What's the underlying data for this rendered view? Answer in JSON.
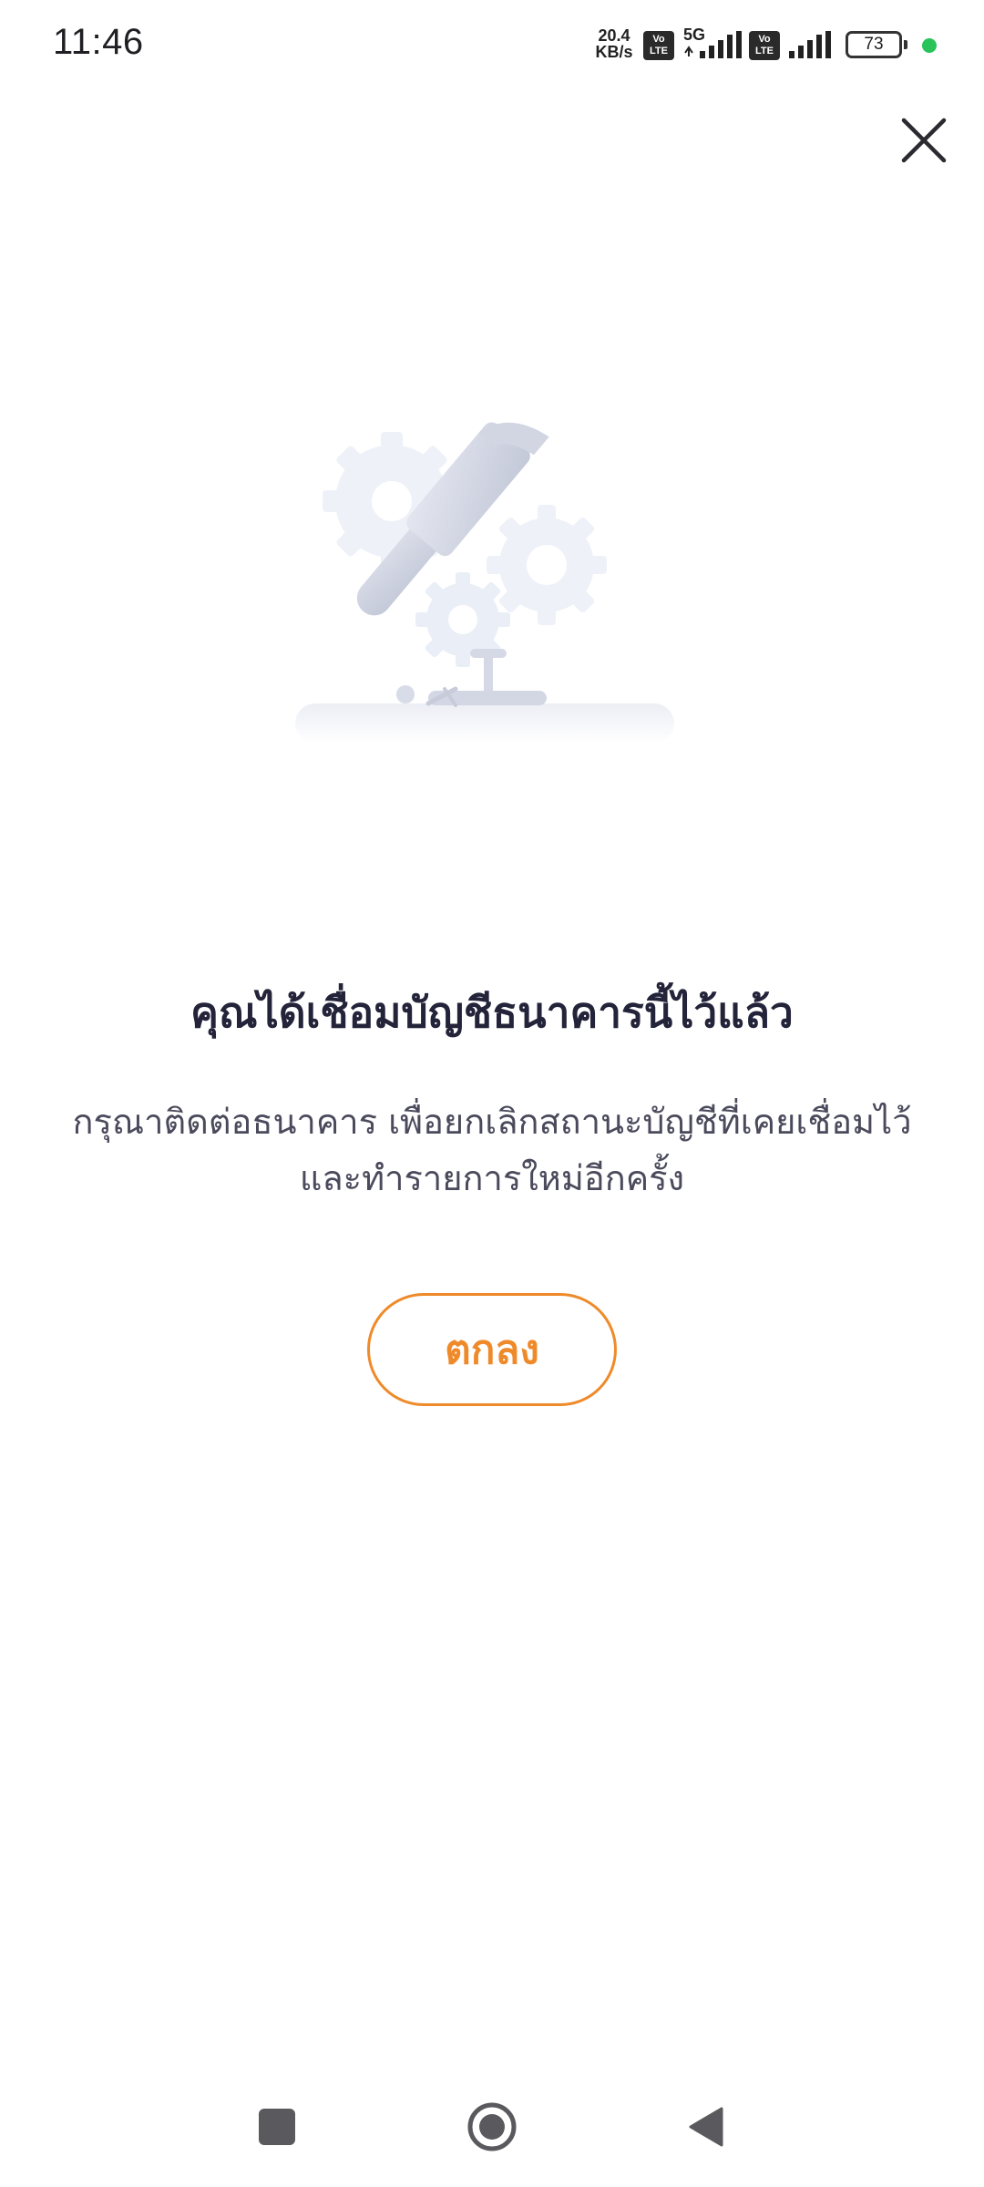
{
  "status_bar": {
    "time": "11:46",
    "net_speed_value": "20.4",
    "net_speed_unit": "KB/s",
    "volte_label": "Vo LTE",
    "network_type": "5G",
    "battery_level": "73"
  },
  "dialog": {
    "title": "คุณได้เชื่อมบัญชีธนาคารนี้ไว้แล้ว",
    "message": "กรุณาติดต่อธนาคาร เพื่อยกเลิกสถานะบัญชีที่เคยเชื่อมไว้ และทำรายการใหม่อีกครั้ง",
    "ok_label": "ตกลง"
  },
  "icons": {
    "close": "close-icon",
    "illustration": "maintenance-hammer-gears-illustration",
    "nav_recent": "square-icon",
    "nav_home": "circle-home-icon",
    "nav_back": "triangle-back-icon"
  },
  "colors": {
    "accent": "#ef8a2a",
    "title": "#23233a",
    "message": "#4a4a5c",
    "battery_dot": "#28c45a"
  }
}
